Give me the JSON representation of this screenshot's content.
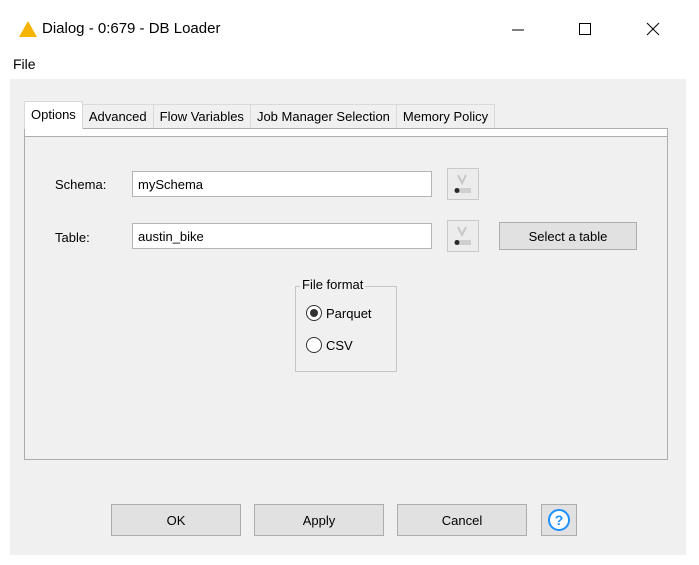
{
  "window": {
    "title": "Dialog - 0:679 - DB Loader"
  },
  "menubar": {
    "file_label": "File"
  },
  "tabs": [
    {
      "label": "Options",
      "active": true
    },
    {
      "label": "Advanced",
      "active": false
    },
    {
      "label": "Flow Variables",
      "active": false
    },
    {
      "label": "Job Manager Selection",
      "active": false
    },
    {
      "label": "Memory Policy",
      "active": false
    }
  ],
  "options": {
    "schema_label": "Schema:",
    "schema_value": "mySchema",
    "table_label": "Table:",
    "table_value": "austin_bike",
    "select_table_label": "Select a table",
    "file_format": {
      "legend": "File format",
      "options": [
        {
          "label": "Parquet",
          "selected": true
        },
        {
          "label": "CSV",
          "selected": false
        }
      ]
    }
  },
  "footer": {
    "ok_label": "OK",
    "apply_label": "Apply",
    "cancel_label": "Cancel",
    "help_glyph": "?"
  },
  "colors": {
    "warning_icon": "#f5b400",
    "help_icon": "#1e90ff"
  }
}
